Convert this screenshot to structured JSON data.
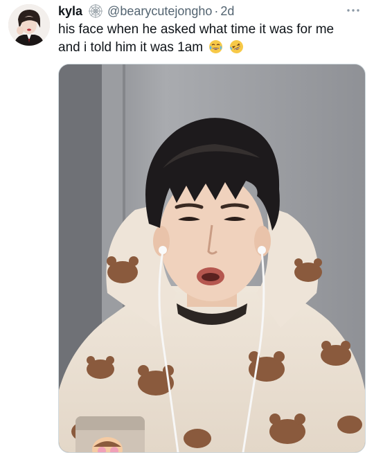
{
  "tweet": {
    "author": {
      "display_name": "kyla",
      "handle": "@bearycutejongho",
      "separator": "·",
      "time": "2d",
      "badge_icon": "spiderweb-icon",
      "avatar_icon": "profile-avatar"
    },
    "text": {
      "line1": "his face when he asked what time it was for me",
      "line2": "and i told him it was 1am",
      "emoji": [
        "crying-laughing-emoji",
        "rolling-on-floor-laughing-emoji"
      ]
    },
    "more_icon": "more-horizontal-icon",
    "media": {
      "kind": "photo",
      "subject": "video-call-screenshot",
      "inset": "picture-in-picture-preview"
    }
  },
  "colors": {
    "text_primary": "#0f1419",
    "text_secondary": "#536471",
    "border": "#cfd9de",
    "background": "#ffffff"
  }
}
